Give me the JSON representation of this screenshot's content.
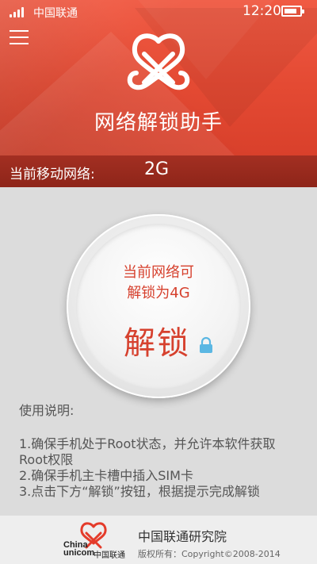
{
  "status_bar": {
    "carrier": "中国联通",
    "time": "12:20",
    "battery_level": 0.85,
    "signal_bars": 4
  },
  "header": {
    "title": "网络解锁助手",
    "menu_icon": "hamburger-menu-icon",
    "logo_icon": "china-unicom-knot-icon"
  },
  "network": {
    "label": "当前移动网络:",
    "value": "2G"
  },
  "unlock": {
    "line1": "当前网络可",
    "line2": "解锁为4G",
    "button_label": "解锁",
    "lock_icon": "lock-icon"
  },
  "instructions": {
    "title": "使用说明:",
    "items": [
      "1.确保手机处于Root状态，并允许本软件获取Root权限",
      "2.确保手机主卡槽中插入SIM卡",
      "3.点击下方“解锁”按钮，根据提示完成解锁"
    ]
  },
  "footer": {
    "brand_en_1": "China",
    "brand_en_2": "unicom",
    "brand_cn": "中国联通",
    "org_name": "中国联通研究院",
    "copyright": "版权所有：Copyright©2008-2014"
  },
  "colors": {
    "header_red": "#e44a33",
    "net_bar": "#9a2b1e",
    "accent_text": "#d6412e",
    "lock_blue": "#5bb7e3"
  }
}
